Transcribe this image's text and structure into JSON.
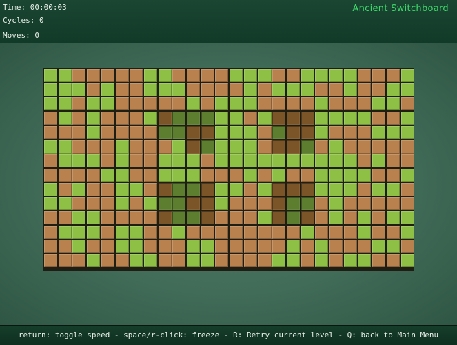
{
  "hud": {
    "time": "Time: 00:00:03",
    "cycles": "Cycles: 0",
    "moves": "Moves: 0",
    "game_title": "Ancient Switchboard"
  },
  "help": "return: toggle speed - space/r-click: freeze - R: Retry current level - Q: back to Main Menu",
  "colors": {
    "on_tile": "#8fc046",
    "off_tile": "#b9814e",
    "frozen_on_tile": "#5d7e2f",
    "frozen_off_tile": "#7b5528",
    "title": "#3fd86a"
  },
  "board": {
    "rows": 14,
    "cols": 26,
    "legend": "G = green, B = brown, lowercase = frozen",
    "grid": [
      "GGBBBBBGGBBBBGGGBBGGGGBBBG",
      "GGGBGBBGGGBBBBGBGGGBBGBBGG",
      "GGBGGBBBBBGBGGGBBBBGBBBGGB",
      "BGBGBBBGbgggGGBGbbbGGGGBBG",
      "BBBGBBBBggbbGGGBgbbGBBBGGG",
      "GGBBBGBBBGbgGGGBbbgBGBBBBB",
      "BGGGBGBBGGGBGGGGGGGGGGBGBB",
      "BBBBGGBBGGGBBBGBGBBGGGGBBG",
      "GBGBBGGBbggbGGBGbbbGGGBGGB",
      "GGBBBGBGggbbGBBBbggBGBBBBB",
      "BBGGBBBBbggbBBBGbgbBGBGBGG",
      "BGGGBGGBBGBBBBBBBBGBBBGBBG",
      "BBGBBGGBBBGGBBBBBGBGBBBGGB",
      "BBBGBBGGBBGGBBBBGGBGBGGBBG"
    ]
  }
}
